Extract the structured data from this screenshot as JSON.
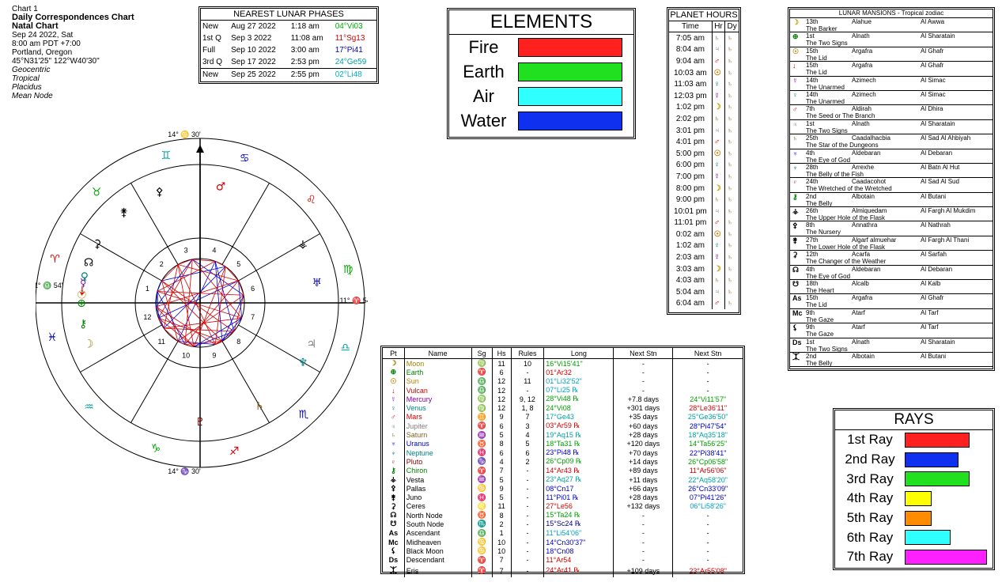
{
  "header": {
    "chart_id": "Chart 1",
    "title": "Daily Correspondences Chart",
    "subtitle": "Natal Chart",
    "date": "Sep 24 2022, Sat",
    "time": "8:00 am  PDT +7:00",
    "place": "Portland, Oregon",
    "coords": "45°N31'25\"  122°W40'30\"",
    "options": [
      "Geocentric",
      "Tropical",
      "Placidus",
      "Mean Node"
    ]
  },
  "lunar": {
    "title": "NEAREST LUNAR PHASES",
    "rows": [
      {
        "phase": "New",
        "date": "Aug 27 2022",
        "time": "1:18 am",
        "pos": "04°Vi03",
        "color": "#00b000"
      },
      {
        "phase": "1st Q",
        "date": "Sep 3 2022",
        "time": "11:08 am",
        "pos": "11°Sg13",
        "color": "#d00000"
      },
      {
        "phase": "Full",
        "date": "Sep 10 2022",
        "time": "3:00 am",
        "pos": "17°Pi41",
        "color": "#0000c0"
      },
      {
        "phase": "3rd Q",
        "date": "Sep 17 2022",
        "time": "2:53 pm",
        "pos": "24°Ge59",
        "color": "#00a0a0"
      },
      {
        "phase": "New",
        "date": "Sep 25 2022",
        "time": "2:55 pm",
        "pos": "02°Li48",
        "color": "#00b0d0"
      }
    ]
  },
  "elements": {
    "title": "ELEMENTS",
    "items": [
      {
        "name": "Fire",
        "color": "#ff2020"
      },
      {
        "name": "Earth",
        "color": "#20e020"
      },
      {
        "name": "Air",
        "color": "#30ffff"
      },
      {
        "name": "Water",
        "color": "#1030f0"
      }
    ]
  },
  "hours": {
    "title": "PLANET HOURS",
    "col_time": "Time",
    "col_hr": "Hr",
    "col_dy": "Dy",
    "day_glyph": "♄",
    "rows": [
      {
        "time": "7:05 am",
        "hr": "♄",
        "c": "#806020"
      },
      {
        "time": "8:04 am",
        "hr": "♃",
        "c": "#808080"
      },
      {
        "time": "9:04 am",
        "hr": "♂",
        "c": "#d00000"
      },
      {
        "time": "10:03 am",
        "hr": "☉",
        "c": "#c08000"
      },
      {
        "time": "11:03 am",
        "hr": "♀",
        "c": "#008080"
      },
      {
        "time": "12:03 pm",
        "hr": "☿",
        "c": "#8000a0"
      },
      {
        "time": "1:02 pm",
        "hr": "☽",
        "c": "#c0a000"
      },
      {
        "time": "2:02 pm",
        "hr": "♄",
        "c": "#806020"
      },
      {
        "time": "3:01 pm",
        "hr": "♃",
        "c": "#808080"
      },
      {
        "time": "4:01 pm",
        "hr": "♂",
        "c": "#d00000"
      },
      {
        "time": "5:00 pm",
        "hr": "☉",
        "c": "#c08000"
      },
      {
        "time": "6:00 pm",
        "hr": "♀",
        "c": "#008080"
      },
      {
        "time": "7:00 pm",
        "hr": "☿",
        "c": "#8000a0"
      },
      {
        "time": "8:00 pm",
        "hr": "☽",
        "c": "#c0a000"
      },
      {
        "time": "9:00 pm",
        "hr": "♄",
        "c": "#806020"
      },
      {
        "time": "10:01 pm",
        "hr": "♃",
        "c": "#808080"
      },
      {
        "time": "11:01 pm",
        "hr": "♂",
        "c": "#d00000"
      },
      {
        "time": "0:02 am",
        "hr": "☉",
        "c": "#c08000"
      },
      {
        "time": "1:02 am",
        "hr": "♀",
        "c": "#008080"
      },
      {
        "time": "2:03 am",
        "hr": "☿",
        "c": "#8000a0"
      },
      {
        "time": "3:03 am",
        "hr": "☽",
        "c": "#c0a000"
      },
      {
        "time": "4:03 am",
        "hr": "♄",
        "c": "#806020"
      },
      {
        "time": "5:04 am",
        "hr": "♃",
        "c": "#808080"
      },
      {
        "time": "6:04 am",
        "hr": "♂",
        "c": "#d00000"
      }
    ]
  },
  "mansions": {
    "title": "LUNAR MANSIONS - Tropical zodiac",
    "rows": [
      {
        "g": "☽",
        "c": "#c0a000",
        "n": "13th",
        "a": "Alahue",
        "b": "Al Awwa",
        "t": "The Barker"
      },
      {
        "g": "⊕",
        "c": "#008000",
        "n": "1st",
        "a": "Alnath",
        "b": "Al Sharatain",
        "t": "The Two Signs"
      },
      {
        "g": "☉",
        "c": "#c08000",
        "n": "15th",
        "a": "Argafra",
        "b": "Al Ghafr",
        "t": "The Lid"
      },
      {
        "g": "↓",
        "c": "#d00000",
        "n": "15th",
        "a": "Argafra",
        "b": "Al Ghafr",
        "t": "The Lid"
      },
      {
        "g": "☿",
        "c": "#8000a0",
        "n": "14th",
        "a": "Azimech",
        "b": "Al Simac",
        "t": "The Unarmed"
      },
      {
        "g": "♀",
        "c": "#008080",
        "n": "14th",
        "a": "Azimech",
        "b": "Al Simac",
        "t": "The Unarmed"
      },
      {
        "g": "♂",
        "c": "#d00000",
        "n": "7th",
        "a": "Aldirah",
        "b": "Al Dhira",
        "t": "The Seed or The Branch"
      },
      {
        "g": "♃",
        "c": "#808080",
        "n": "1st",
        "a": "Alnath",
        "b": "Al Sharatain",
        "t": "The Two Signs"
      },
      {
        "g": "♄",
        "c": "#806020",
        "n": "25th",
        "a": "Caadalhacbia",
        "b": "Al Sad Al Ahbiyah",
        "t": "The Star of the Dungeons"
      },
      {
        "g": "♅",
        "c": "#0000c0",
        "n": "4th",
        "a": "Aldebaran",
        "b": "Al Debaran",
        "t": "The Eye of God"
      },
      {
        "g": "♆",
        "c": "#008080",
        "n": "28th",
        "a": "Arrexhe",
        "b": "Al Batn Al Hut",
        "t": "The Belly of the Fish"
      },
      {
        "g": "♇",
        "c": "#800000",
        "n": "24th",
        "a": "Caadacohot",
        "b": "Al Sad Al Sud",
        "t": "The Wretched of the Wretched"
      },
      {
        "g": "⚷",
        "c": "#008000",
        "n": "2nd",
        "a": "Albotain",
        "b": "Al Butani",
        "t": "The Belly"
      },
      {
        "g": "⚶",
        "c": "#000000",
        "n": "26th",
        "a": "Almiquedam",
        "b": "Al Fargh Al Mukdim",
        "t": "The Upper Hole of the Flask"
      },
      {
        "g": "⚴",
        "c": "#000000",
        "n": "8th",
        "a": "Annathra",
        "b": "Al Nathrah",
        "t": "The Nursery"
      },
      {
        "g": "⚵",
        "c": "#000000",
        "n": "27th",
        "a": "Algarf almuehar",
        "b": "Al Fargh Al Thani",
        "t": "The Lower Hole of the Flask"
      },
      {
        "g": "⚳",
        "c": "#000000",
        "n": "12th",
        "a": "Acarfa",
        "b": "Al Sarfah",
        "t": "The Changer of the Weather"
      },
      {
        "g": "☊",
        "c": "#000000",
        "n": "4th",
        "a": "Aldebaran",
        "b": "Al Debaran",
        "t": "The Eye of God"
      },
      {
        "g": "☋",
        "c": "#000000",
        "n": "18th",
        "a": "Alcalb",
        "b": "Al Kalb",
        "t": "The Heart"
      },
      {
        "g": "As",
        "c": "#000000",
        "n": "15th",
        "a": "Argafra",
        "b": "Al Ghafr",
        "t": "The Lid"
      },
      {
        "g": "Mc",
        "c": "#000000",
        "n": "9th",
        "a": "Atarf",
        "b": "Al Tarf",
        "t": "The Gaze"
      },
      {
        "g": "⚸",
        "c": "#000000",
        "n": "9th",
        "a": "Atarf",
        "b": "Al Tarf",
        "t": "The Gaze"
      },
      {
        "g": "Ds",
        "c": "#000000",
        "n": "1st",
        "a": "Alnath",
        "b": "Al Sharatain",
        "t": "The Two Signs"
      },
      {
        "g": "⯰",
        "c": "#000000",
        "n": "2nd",
        "a": "Albotain",
        "b": "Al Butani",
        "t": "The Belly"
      }
    ]
  },
  "planets": {
    "headers": [
      "Pt",
      "Name",
      "Sg",
      "Hs",
      "Rules",
      "Long",
      "Next Stn",
      "Next Stn"
    ],
    "rows": [
      {
        "g": "☽",
        "name": "Moon",
        "c": "#a08000",
        "sg": "♍",
        "hs": "11",
        "rules": "10",
        "long": "16°Vi15'41\"",
        "lc": "#00a000",
        "s1": "-",
        "s2": "-",
        "s2c": "#000"
      },
      {
        "g": "⊕",
        "name": "Earth",
        "c": "#008000",
        "sg": "♈",
        "hs": "6",
        "rules": "-",
        "long": "01°Ar32",
        "lc": "#d00000",
        "s1": "-",
        "s2": "-",
        "s2c": "#000"
      },
      {
        "g": "☉",
        "name": "Sun",
        "c": "#c08000",
        "sg": "♎",
        "hs": "12",
        "rules": "11",
        "long": "01°Li32'52\"",
        "lc": "#00a0c0",
        "s1": "-",
        "s2": "-",
        "s2c": "#000"
      },
      {
        "g": "↓",
        "name": "Vulcan",
        "c": "#d00000",
        "sg": "♎",
        "hs": "12",
        "rules": "-",
        "long": "07°Li25 ℞",
        "lc": "#00a0c0",
        "s1": "-",
        "s2": "-",
        "s2c": "#000"
      },
      {
        "g": "☿",
        "name": "Mercury",
        "c": "#8000a0",
        "sg": "♍",
        "hs": "12",
        "rules": "9, 12",
        "long": "28°Vi48 ℞",
        "lc": "#00a000",
        "s1": "+7.8 days",
        "s2": "24°Vi11'57\"",
        "s2c": "#00a000"
      },
      {
        "g": "♀",
        "name": "Venus",
        "c": "#008080",
        "sg": "♍",
        "hs": "12",
        "rules": "1, 8",
        "long": "24°Vi08",
        "lc": "#00a000",
        "s1": "+301 days",
        "s2": "28°Le36'11\"",
        "s2c": "#d00000"
      },
      {
        "g": "♂",
        "name": "Mars",
        "c": "#d00000",
        "sg": "♊",
        "hs": "9",
        "rules": "7",
        "long": "17°Ge43",
        "lc": "#00a0a0",
        "s1": "+35 days",
        "s2": "25°Ge36'50\"",
        "s2c": "#00a0a0"
      },
      {
        "g": "♃",
        "name": "Jupiter",
        "c": "#808080",
        "sg": "♈",
        "hs": "6",
        "rules": "3",
        "long": "03°Ar59 ℞",
        "lc": "#d00000",
        "s1": "+60 days",
        "s2": "28°Pi47'54\"",
        "s2c": "#0000c0"
      },
      {
        "g": "♄",
        "name": "Saturn",
        "c": "#806020",
        "sg": "♒",
        "hs": "5",
        "rules": "4",
        "long": "19°Aq15 ℞",
        "lc": "#00a0a0",
        "s1": "+28 days",
        "s2": "18°Aq35'18\"",
        "s2c": "#00a0a0"
      },
      {
        "g": "♅",
        "name": "Uranus",
        "c": "#0000c0",
        "sg": "♉",
        "hs": "8",
        "rules": "5",
        "long": "18°Ta31 ℞",
        "lc": "#00a000",
        "s1": "+120 days",
        "s2": "14°Ta56'25\"",
        "s2c": "#00a000"
      },
      {
        "g": "♆",
        "name": "Neptune",
        "c": "#008080",
        "sg": "♓",
        "hs": "6",
        "rules": "6",
        "long": "23°Pi48 ℞",
        "lc": "#0000c0",
        "s1": "+70 days",
        "s2": "22°Pi38'41\"",
        "s2c": "#0000c0"
      },
      {
        "g": "♇",
        "name": "Pluto",
        "c": "#800000",
        "sg": "♑",
        "hs": "4",
        "rules": "2",
        "long": "26°Cp09 ℞",
        "lc": "#00a000",
        "s1": "+14 days",
        "s2": "26°Cp06'58\"",
        "s2c": "#00a000"
      },
      {
        "g": "⚷",
        "name": "Chiron",
        "c": "#008000",
        "sg": "♈",
        "hs": "7",
        "rules": "-",
        "long": "14°Ar43 ℞",
        "lc": "#d00000",
        "s1": "+89 days",
        "s2": "11°Ar56'06\"",
        "s2c": "#d00000"
      },
      {
        "g": "⚶",
        "name": "Vesta",
        "c": "#000",
        "sg": "♒",
        "hs": "5",
        "rules": "-",
        "long": "23°Aq27 ℞",
        "lc": "#00a0a0",
        "s1": "+11 days",
        "s2": "22°Aq58'20\"",
        "s2c": "#00a0a0"
      },
      {
        "g": "⚴",
        "name": "Pallas",
        "c": "#000",
        "sg": "♋",
        "hs": "9",
        "rules": "-",
        "long": "08°Cn17",
        "lc": "#0000c0",
        "s1": "+66 days",
        "s2": "26°Cn33'09\"",
        "s2c": "#0000c0"
      },
      {
        "g": "⚵",
        "name": "Juno",
        "c": "#000",
        "sg": "♓",
        "hs": "5",
        "rules": "-",
        "long": "11°Pi01 ℞",
        "lc": "#0000c0",
        "s1": "+28 days",
        "s2": "07°Pi41'26\"",
        "s2c": "#0000c0"
      },
      {
        "g": "⚳",
        "name": "Ceres",
        "c": "#000",
        "sg": "♌",
        "hs": "11",
        "rules": "-",
        "long": "27°Le56",
        "lc": "#d00000",
        "s1": "+132 days",
        "s2": "06°Li58'26\"",
        "s2c": "#00a0c0"
      },
      {
        "g": "☊",
        "name": "North Node",
        "c": "#000",
        "sg": "♉",
        "hs": "8",
        "rules": "-",
        "long": "15°Ta24 ℞",
        "lc": "#00a000",
        "s1": "-",
        "s2": "-",
        "s2c": "#000"
      },
      {
        "g": "☋",
        "name": "South Node",
        "c": "#000",
        "sg": "♏",
        "hs": "2",
        "rules": "-",
        "long": "15°Sc24 ℞",
        "lc": "#000080",
        "s1": "-",
        "s2": "-",
        "s2c": "#000"
      },
      {
        "g": "As",
        "name": "Ascendant",
        "c": "#000",
        "sg": "♎",
        "hs": "1",
        "rules": "-",
        "long": "11°Li54'06\"",
        "lc": "#00a0c0",
        "s1": "-",
        "s2": "-",
        "s2c": "#000"
      },
      {
        "g": "Mc",
        "name": "Midheaven",
        "c": "#000",
        "sg": "♋",
        "hs": "10",
        "rules": "-",
        "long": "14°Cn30'37\"",
        "lc": "#0000c0",
        "s1": "-",
        "s2": "-",
        "s2c": "#000"
      },
      {
        "g": "⚸",
        "name": "Black Moon",
        "c": "#000",
        "sg": "♋",
        "hs": "10",
        "rules": "-",
        "long": "18°Cn08",
        "lc": "#0000c0",
        "s1": "-",
        "s2": "-",
        "s2c": "#000"
      },
      {
        "g": "Ds",
        "name": "Descendant",
        "c": "#000",
        "sg": "♈",
        "hs": "7",
        "rules": "-",
        "long": "11°Ar54",
        "lc": "#d00000",
        "s1": "-",
        "s2": "-",
        "s2c": "#000"
      },
      {
        "g": "⯰",
        "name": "Eris",
        "c": "#000",
        "sg": "♈",
        "hs": "7",
        "rules": "-",
        "long": "24°Ar41 ℞",
        "lc": "#d00000",
        "s1": "+109 days",
        "s2": "23°Ar55'08\"",
        "s2c": "#d00000"
      }
    ]
  },
  "rays": {
    "title": "RAYS",
    "items": [
      {
        "name": "1st Ray",
        "color": "#ff2020",
        "level": 0.67
      },
      {
        "name": "2nd Ray",
        "color": "#1030f0",
        "level": 0.55
      },
      {
        "name": "3rd Ray",
        "color": "#20e020",
        "level": 0.67
      },
      {
        "name": "4th Ray",
        "color": "#ffff00",
        "level": 0.27
      },
      {
        "name": "5th Ray",
        "color": "#ff8c00",
        "level": 0.27
      },
      {
        "name": "6th Ray",
        "color": "#30ffff",
        "level": 0.47
      },
      {
        "name": "7th Ray",
        "color": "#ff20ff",
        "level": 0.85
      }
    ]
  },
  "wheel": {
    "cusp_labels": [
      {
        "house": "1",
        "deg": "11°",
        "sign": "♎",
        "min": "54'"
      },
      {
        "house": "4",
        "deg": "14°",
        "sign": "♑",
        "min": "30'"
      },
      {
        "house": "7",
        "deg": "11°",
        "sign": "♈",
        "min": "54'"
      },
      {
        "house": "10",
        "deg": "14°",
        "sign": "♋",
        "min": "30'"
      }
    ],
    "house_numbers": [
      "1",
      "2",
      "3",
      "4",
      "5",
      "6",
      "7",
      "8",
      "9",
      "10",
      "11",
      "12"
    ],
    "sign_glyphs": [
      "♈",
      "♉",
      "♊",
      "♋",
      "♌",
      "♍",
      "♎",
      "♏",
      "♐",
      "♑",
      "♒",
      "♓"
    ]
  }
}
